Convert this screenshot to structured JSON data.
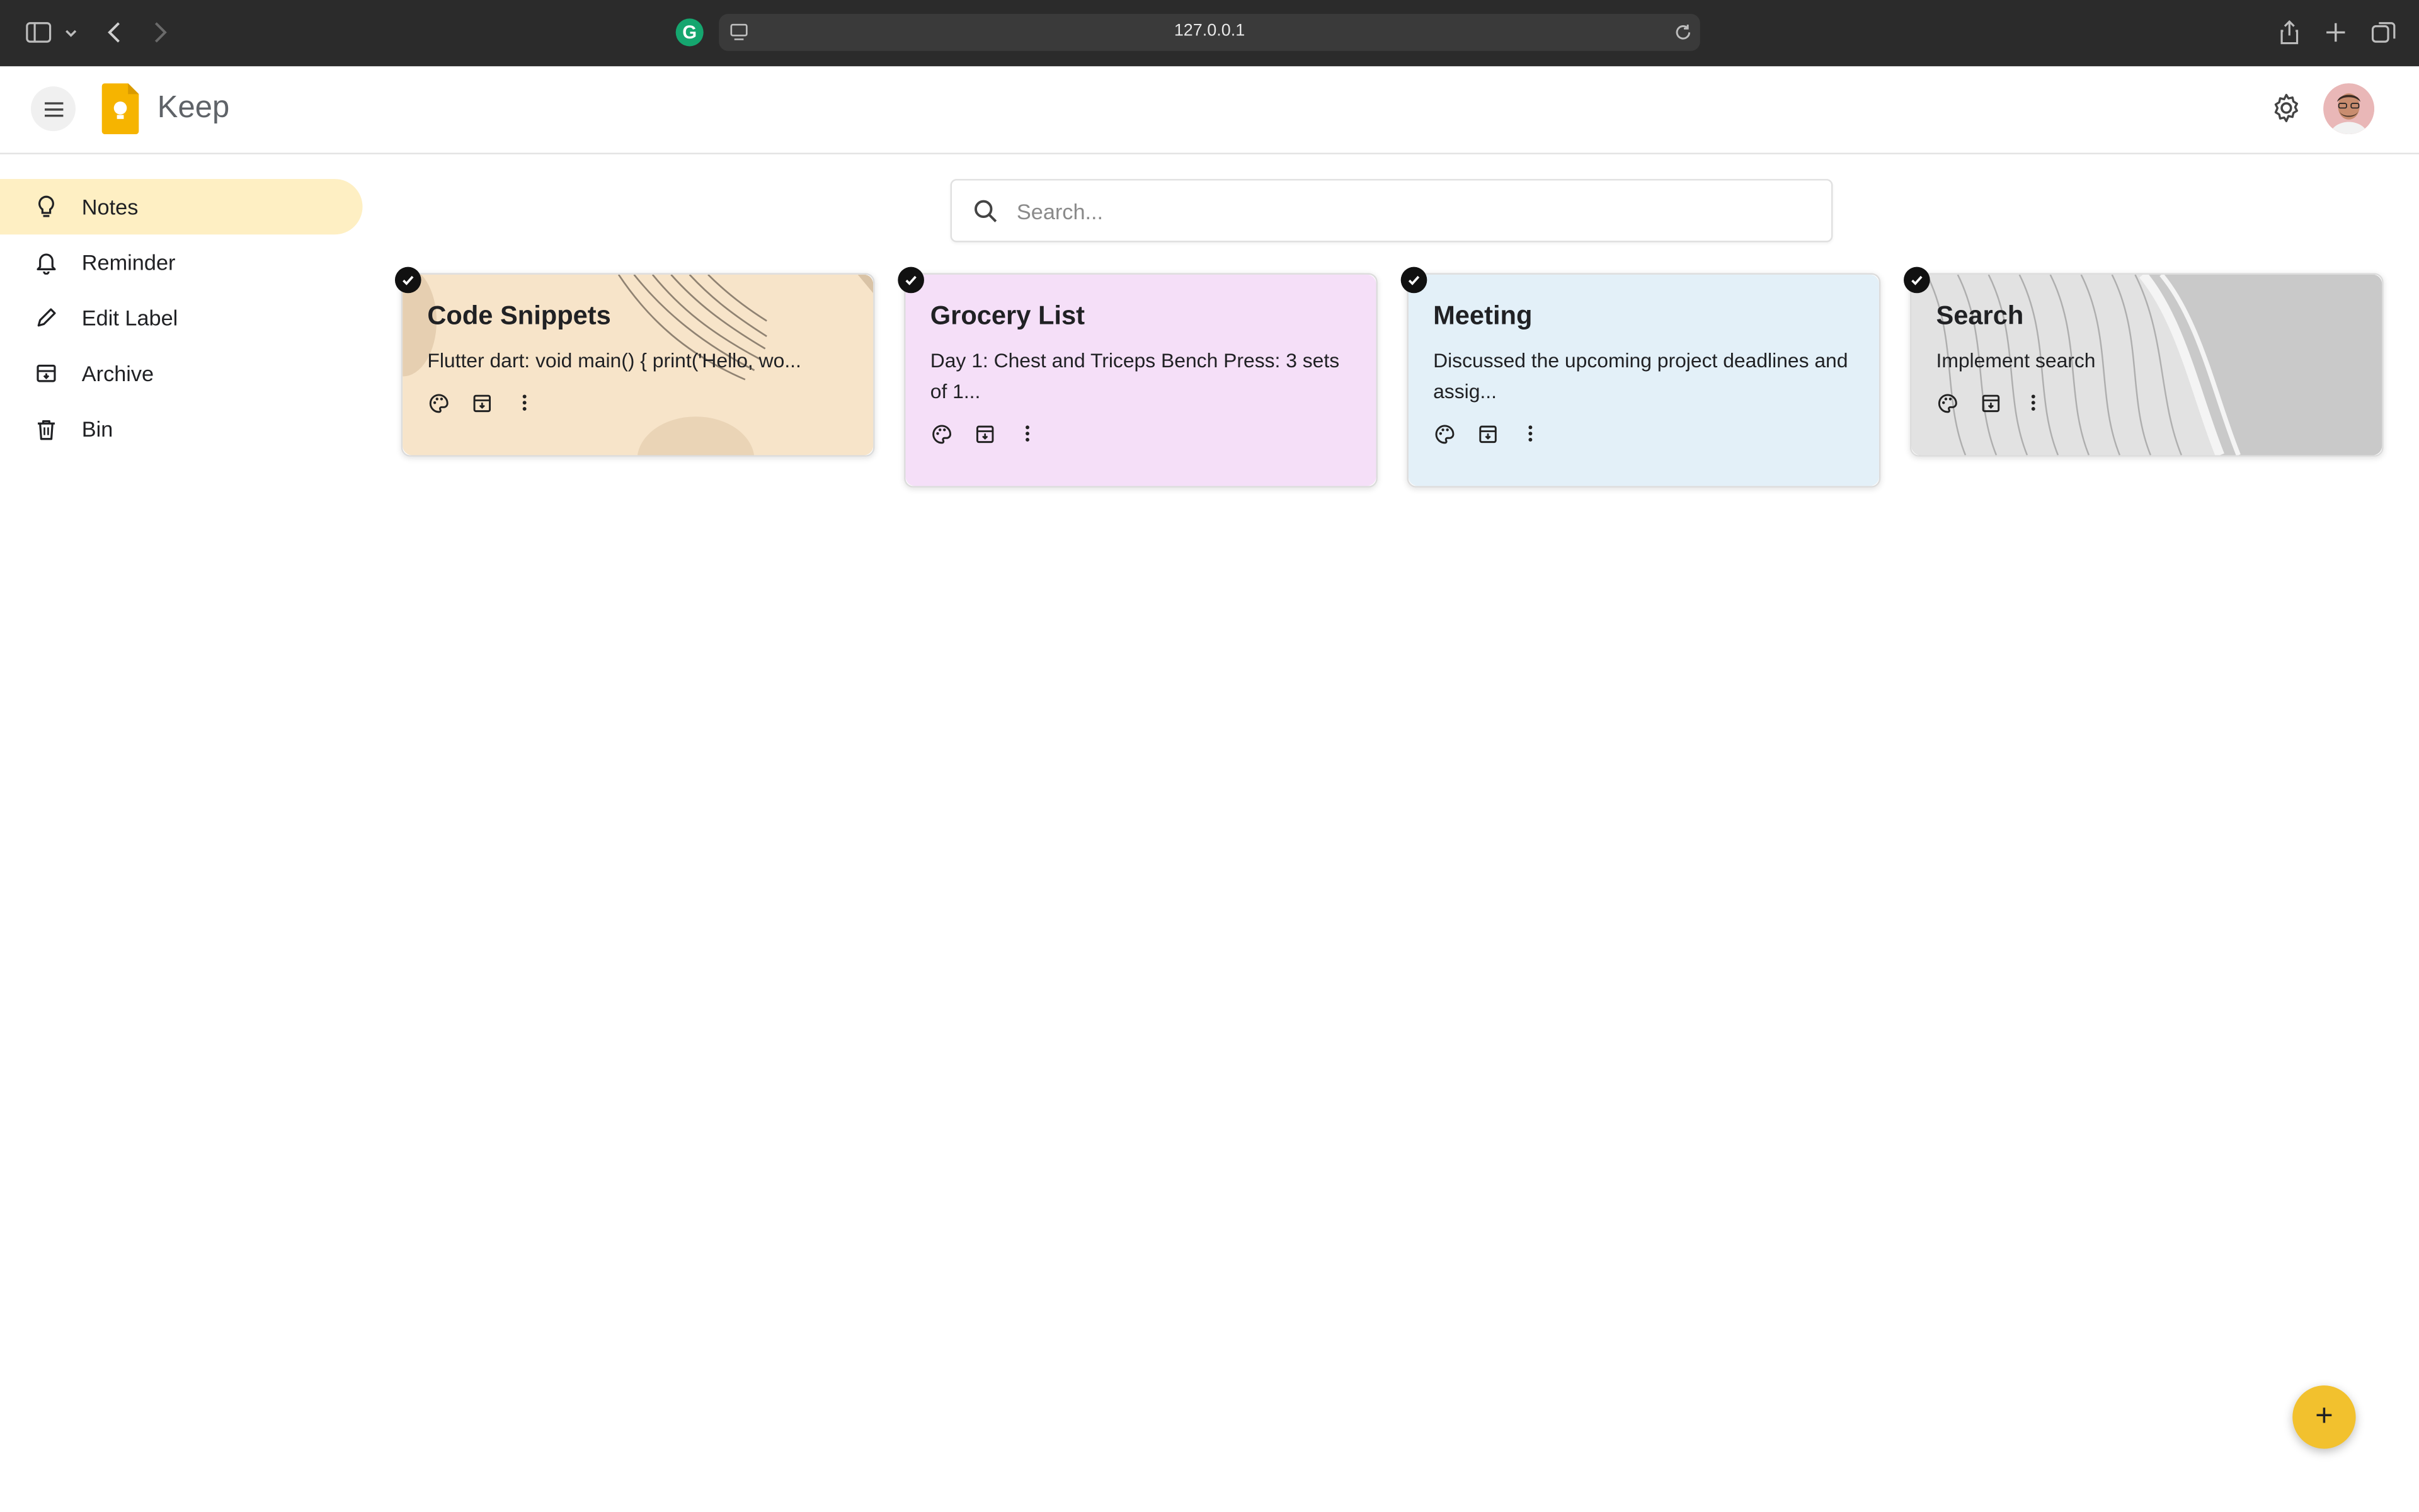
{
  "browser": {
    "url": "127.0.0.1",
    "extension_letter": "G"
  },
  "header": {
    "brand": "Keep"
  },
  "sidebar": {
    "items": [
      {
        "label": "Notes",
        "icon": "lightbulb-icon",
        "active": true
      },
      {
        "label": "Reminder",
        "icon": "bell-icon",
        "active": false
      },
      {
        "label": "Edit Label",
        "icon": "pencil-icon",
        "active": false
      },
      {
        "label": "Archive",
        "icon": "archive-icon",
        "active": false
      },
      {
        "label": "Bin",
        "icon": "trash-icon",
        "active": false
      }
    ]
  },
  "search": {
    "placeholder": "Search..."
  },
  "notes": [
    {
      "title": "Code Snippets",
      "body": "Flutter dart: void main() { print('Hello, wo...",
      "color": "#f7e4c9"
    },
    {
      "title": "Grocery List",
      "body": "Day 1: Chest and Triceps Bench Press: 3 sets of 1...",
      "color": "#f5dff8"
    },
    {
      "title": "Meeting",
      "body": "Discussed the upcoming project deadlines and assig...",
      "color": "#e3f0f8"
    },
    {
      "title": "Search",
      "body": "Implement search",
      "color": "#cfcfcf"
    }
  ],
  "fab": {
    "label": "+"
  },
  "colors": {
    "accent": "#f2c12e",
    "active_nav": "#feefc3"
  }
}
